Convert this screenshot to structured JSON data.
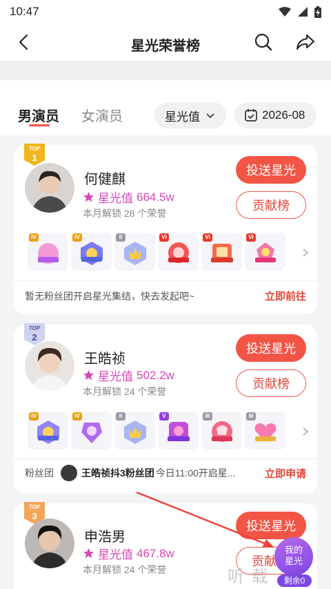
{
  "status_bar": {
    "time": "10:47"
  },
  "nav": {
    "title": "星光荣誉榜"
  },
  "tabs": {
    "male": "男演员",
    "female": "女演员"
  },
  "filters": {
    "sort_label": "星光值",
    "date_label": "2026-08"
  },
  "cards": [
    {
      "rank_top": "TOP",
      "rank_num": "1",
      "name": "何健麒",
      "star_label": "星光值",
      "star_value": "664.5w",
      "unlock_text": "本月解锁 28 个荣誉",
      "send_label": "投送星光",
      "contrib_label": "贡献榜",
      "medal_levels": [
        "IV",
        "IV",
        "II",
        "VI",
        "VI",
        "VI"
      ],
      "footer_text": "暂无粉丝团开启星光集结，快去发起吧~",
      "footer_link": "立即前往"
    },
    {
      "rank_top": "TOP",
      "rank_num": "2",
      "name": "王皓祯",
      "star_label": "星光值",
      "star_value": "502.2w",
      "unlock_text": "本月解锁 24 个荣誉",
      "send_label": "投送星光",
      "contrib_label": "贡献榜",
      "medal_levels": [
        "IV",
        "IV",
        "II",
        "V",
        "III",
        "III"
      ],
      "fan_prefix": "粉丝团",
      "fan_name": "王皓祯抖3粉丝团",
      "fan_text": "今日11:00开启星...",
      "footer_link": "立即申请"
    },
    {
      "rank_top": "TOP",
      "rank_num": "3",
      "name": "申浩男",
      "star_label": "星光值",
      "star_value": "467.8w",
      "unlock_text": "本月解锁 24 个荣誉",
      "send_label": "投送星光",
      "contrib_label": "贡献"
    }
  ],
  "floating": {
    "line1": "我的",
    "line2": "星光",
    "remain": "剩余0"
  },
  "watermark": "听 载",
  "colors": {
    "accent": "#f25445",
    "star": "#d647b6",
    "float": "#8a4fe6",
    "gold": "#f0b51b"
  }
}
